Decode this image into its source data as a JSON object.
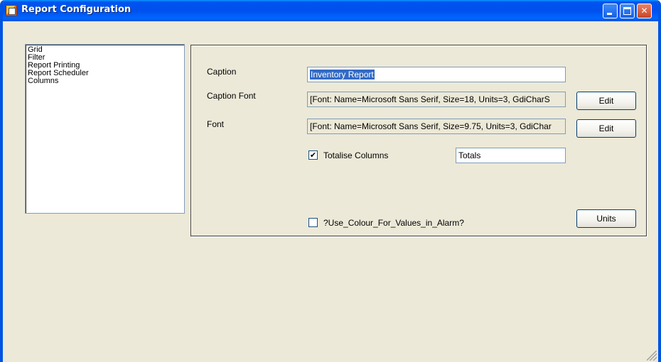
{
  "window": {
    "title": "Report Configuration"
  },
  "titlebar_buttons": {
    "minimize_icon": "minimize-icon",
    "maximize_icon": "maximize-icon",
    "close_icon": "close-icon",
    "close_glyph": "✕"
  },
  "nav_list": {
    "items": [
      "Grid",
      "Filter",
      "Report Printing",
      "Report Scheduler",
      "Columns"
    ]
  },
  "settings": {
    "caption_label": "Caption",
    "caption_value": "Inventory Report",
    "caption_font_label": "Caption Font",
    "caption_font_value": "[Font: Name=Microsoft Sans Serif, Size=18, Units=3, GdiCharS",
    "caption_font_edit_label": "Edit",
    "font_label": "Font",
    "font_value": "[Font: Name=Microsoft Sans Serif, Size=9.75, Units=3, GdiChar",
    "font_edit_label": "Edit",
    "totalise_label": "Totalise Columns",
    "totalise_checked": true,
    "totalise_check_glyph": "✔",
    "totals_value": "Totals",
    "alarm_colour_label": "?Use_Colour_For_Values_in_Alarm?",
    "alarm_colour_checked": false,
    "units_label": "Units"
  },
  "colors": {
    "titlebar": "#0054e3",
    "window_bg": "#ece9d8",
    "selection": "#316ac5"
  }
}
